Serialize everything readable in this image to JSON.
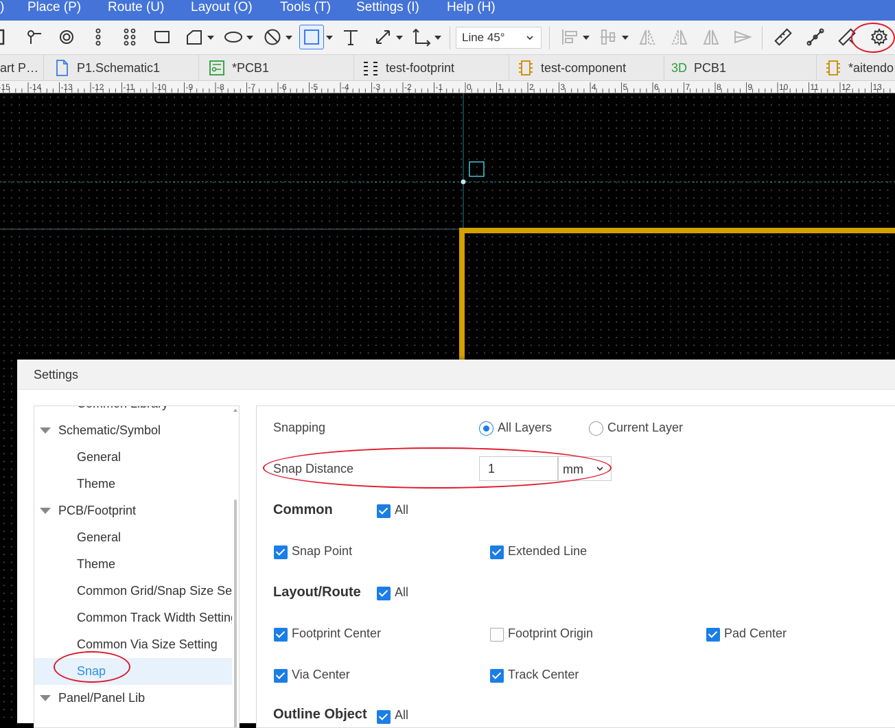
{
  "menubar": {
    "items": [
      ")",
      "Place (P)",
      "Route (U)",
      "Layout (O)",
      "Tools (T)",
      "Settings (I)",
      "Help (H)"
    ]
  },
  "toolbar": {
    "line_mode": "Line 45°",
    "tools": [
      "partial-tool-icon",
      "connect-pin-icon",
      "via-icon",
      "pad-column-icon",
      "pad-grid-icon",
      "rounded-rect-icon",
      "polygon-icon",
      "ellipse-icon",
      "no-fill-circle-icon",
      "rectangle-icon",
      "text-icon",
      "dimension-icon",
      "angle-dimension-icon",
      "align-left-icon",
      "distribute-icon",
      "flip-horizontal-icon",
      "flip-horizontal-alt-icon",
      "mirror-icon",
      "send-icon",
      "ruler-icon",
      "measure-icon",
      "ruler-alt-icon",
      "gear-icon"
    ]
  },
  "tabs": [
    {
      "label": "art P…",
      "icon": "none"
    },
    {
      "label": "P1.Schematic1",
      "icon": "schematic-doc-icon"
    },
    {
      "label": "*PCB1",
      "icon": "pcb-icon"
    },
    {
      "label": "test-footprint",
      "icon": "footprint-icon"
    },
    {
      "label": "test-component",
      "icon": "component-icon"
    },
    {
      "label": "PCB1",
      "icon": "3d-icon",
      "prefix": "3D"
    },
    {
      "label": "*aitendo",
      "icon": "component-icon"
    }
  ],
  "ruler": {
    "labels": [
      "-15",
      "-14",
      "-13",
      "-12",
      "-11",
      "-10",
      "-9",
      "-8",
      "-7",
      "-6",
      "-5",
      "-4",
      "-3",
      "-2",
      "-1",
      "0",
      "1",
      "2",
      "3",
      "4",
      "5",
      "6",
      "7",
      "8",
      "9",
      "10",
      "11",
      "12",
      "13"
    ]
  },
  "colors": {
    "menubar": "#4574d8",
    "board_outline": "#d4a000",
    "accent": "#1b7ee6",
    "highlight": "#e01a2c",
    "crosshair": "#3fb8c8"
  },
  "dialog": {
    "title": "Settings",
    "tree": [
      {
        "label": "Common Library",
        "level": 1
      },
      {
        "label": "Schematic/Symbol",
        "level": 0
      },
      {
        "label": "General",
        "level": 1
      },
      {
        "label": "Theme",
        "level": 1
      },
      {
        "label": "PCB/Footprint",
        "level": 0
      },
      {
        "label": "General",
        "level": 1
      },
      {
        "label": "Theme",
        "level": 1
      },
      {
        "label": "Common Grid/Snap Size Setting",
        "level": 1
      },
      {
        "label": "Common Track Width Setting",
        "level": 1
      },
      {
        "label": "Common Via Size Setting",
        "level": 1
      },
      {
        "label": "Snap",
        "level": 1,
        "selected": true
      },
      {
        "label": "Panel/Panel Lib",
        "level": 0
      }
    ],
    "snapping": {
      "label": "Snapping",
      "options": [
        {
          "label": "All Layers",
          "selected": true
        },
        {
          "label": "Current Layer",
          "selected": false
        }
      ]
    },
    "snap_distance": {
      "label": "Snap Distance",
      "value": "1",
      "unit": "mm"
    },
    "common": {
      "title": "Common",
      "all": {
        "label": "All",
        "checked": true
      },
      "items": [
        {
          "label": "Snap Point",
          "checked": true
        },
        {
          "label": "Extended Line",
          "checked": true
        }
      ]
    },
    "layout_route": {
      "title": "Layout/Route",
      "all": {
        "label": "All",
        "checked": true
      },
      "items": [
        {
          "label": "Footprint Center",
          "checked": true
        },
        {
          "label": "Footprint Origin",
          "checked": false
        },
        {
          "label": "Pad Center",
          "checked": true
        },
        {
          "label": "Via Center",
          "checked": true
        },
        {
          "label": "Track Center",
          "checked": true
        }
      ]
    },
    "outline_object": {
      "title": "Outline Object",
      "all": {
        "label": "All",
        "checked": true
      }
    }
  }
}
